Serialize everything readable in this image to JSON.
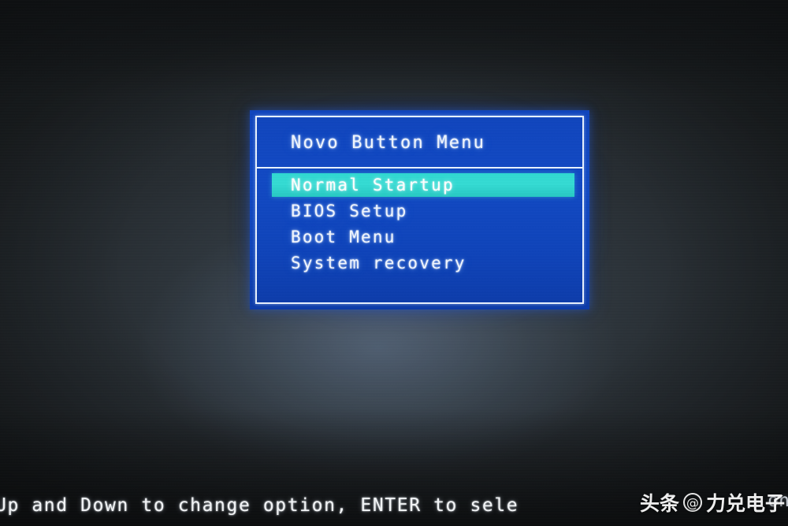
{
  "screen": {
    "background_color": "#2a3036",
    "panel_color": "#1048c4",
    "panel_border_color": "#e8f2ff",
    "highlight_color": "#32d9d2",
    "text_color": "#f2f7ff"
  },
  "dialog": {
    "title": "Novo Button Menu",
    "items": [
      {
        "label": "Normal Startup",
        "selected": true
      },
      {
        "label": "BIOS Setup",
        "selected": false
      },
      {
        "label": "Boot Menu",
        "selected": false
      },
      {
        "label": "System recovery",
        "selected": false
      }
    ]
  },
  "footer": {
    "hint": "Up and Down to change option, ENTER to sele",
    "hint_truncated_tail": "on"
  },
  "watermark": {
    "source": "头条",
    "at_symbol": "@",
    "author": "力兑电子"
  }
}
